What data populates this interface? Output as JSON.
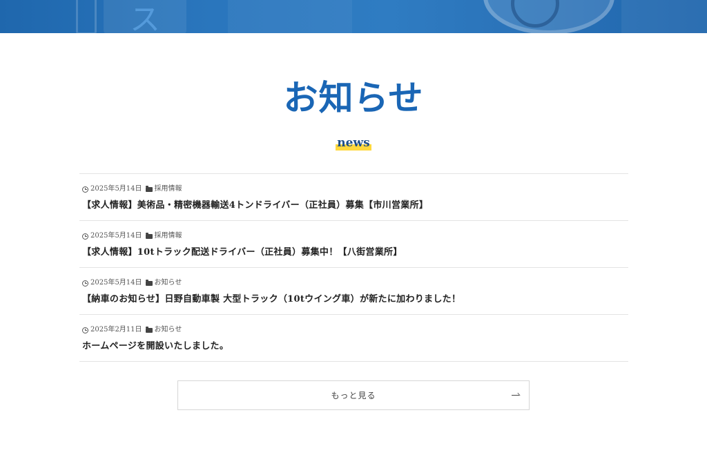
{
  "hero": {
    "banner_color": "#2a76bd"
  },
  "section": {
    "title": "お知らせ",
    "subtitle": "news",
    "title_color": "#1a66b5",
    "highlight_color": "#ffd83d"
  },
  "news": [
    {
      "date": "2025年5月14日",
      "category": "採用情報",
      "title": "【求人情報】美術品・精密機器輸送4トンドライバー（正社員）募集【市川営業所】"
    },
    {
      "date": "2025年5月14日",
      "category": "採用情報",
      "title": "【求人情報】10tトラック配送ドライバー（正社員）募集中！【八街営業所】"
    },
    {
      "date": "2025年5月14日",
      "category": "お知らせ",
      "title": "【納車のお知らせ】日野自動車製 大型トラック（10tウイング車）が新たに加わりました！"
    },
    {
      "date": "2025年2月11日",
      "category": "お知らせ",
      "title": "ホームページを開設いたしました。"
    }
  ],
  "more_button": {
    "label": "もっと見る",
    "icon": "arrow-right-icon"
  }
}
